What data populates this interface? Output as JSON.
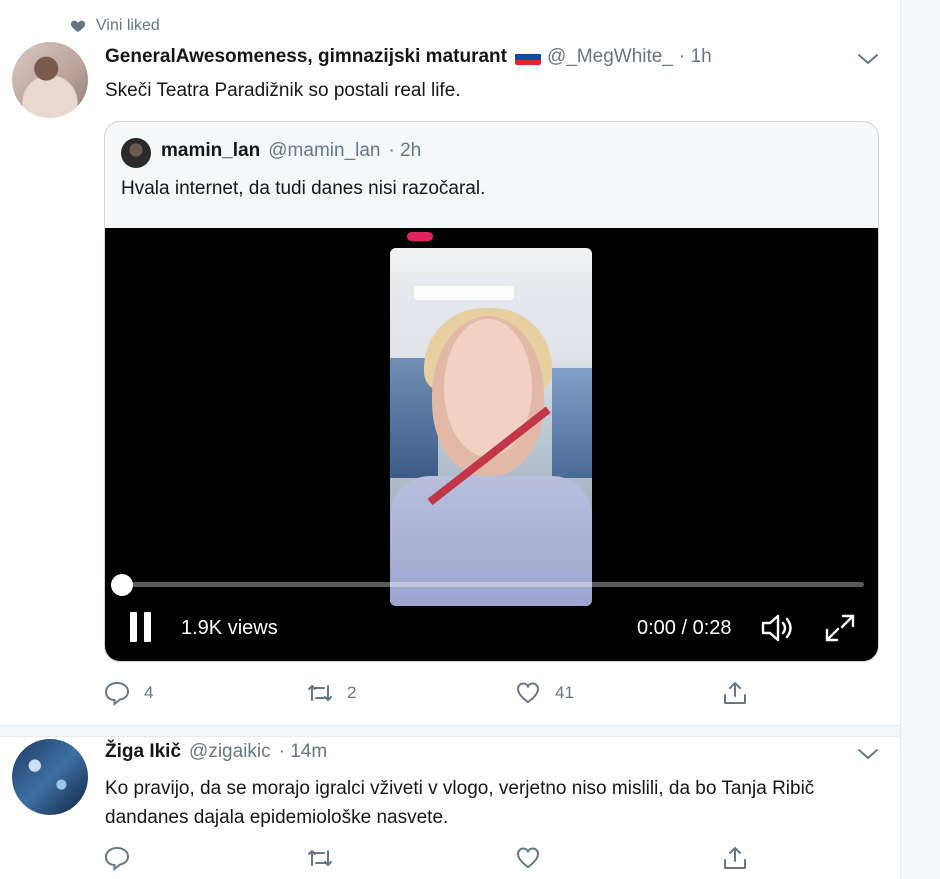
{
  "tweet1": {
    "social_context": "Vini liked",
    "display_name": "GeneralAwesomeness, gimnazijski maturant",
    "flag_emoji": "slovenia-flag",
    "handle": "@_MegWhite_",
    "time": "· 1h",
    "text": "Skeči Teatra Paradižnik so postali real life.",
    "quote": {
      "display_name": "mamin_lan",
      "handle": "@mamin_lan",
      "time": "· 2h",
      "text": "Hvala internet, da tudi danes nisi razočaral.",
      "video": {
        "views": "1.9K views",
        "timecode": "0:00 / 0:28",
        "progress_fraction": 0.0
      }
    },
    "actions": {
      "reply_count": "4",
      "retweet_count": "2",
      "like_count": "41",
      "share_count": ""
    }
  },
  "tweet2": {
    "display_name": "Žiga Ikič",
    "handle": "@zigaikic",
    "time": "· 14m",
    "text": "Ko pravijo, da se morajo igralci vživeti v vlogo, verjetno niso mislili, da bo Tanja Ribič dandanes dajala epidemiološke nasvete."
  },
  "colors": {
    "text_primary": "#14171a",
    "text_secondary": "#657786",
    "border": "#ccd6dd",
    "background": "#f5f8fa"
  }
}
